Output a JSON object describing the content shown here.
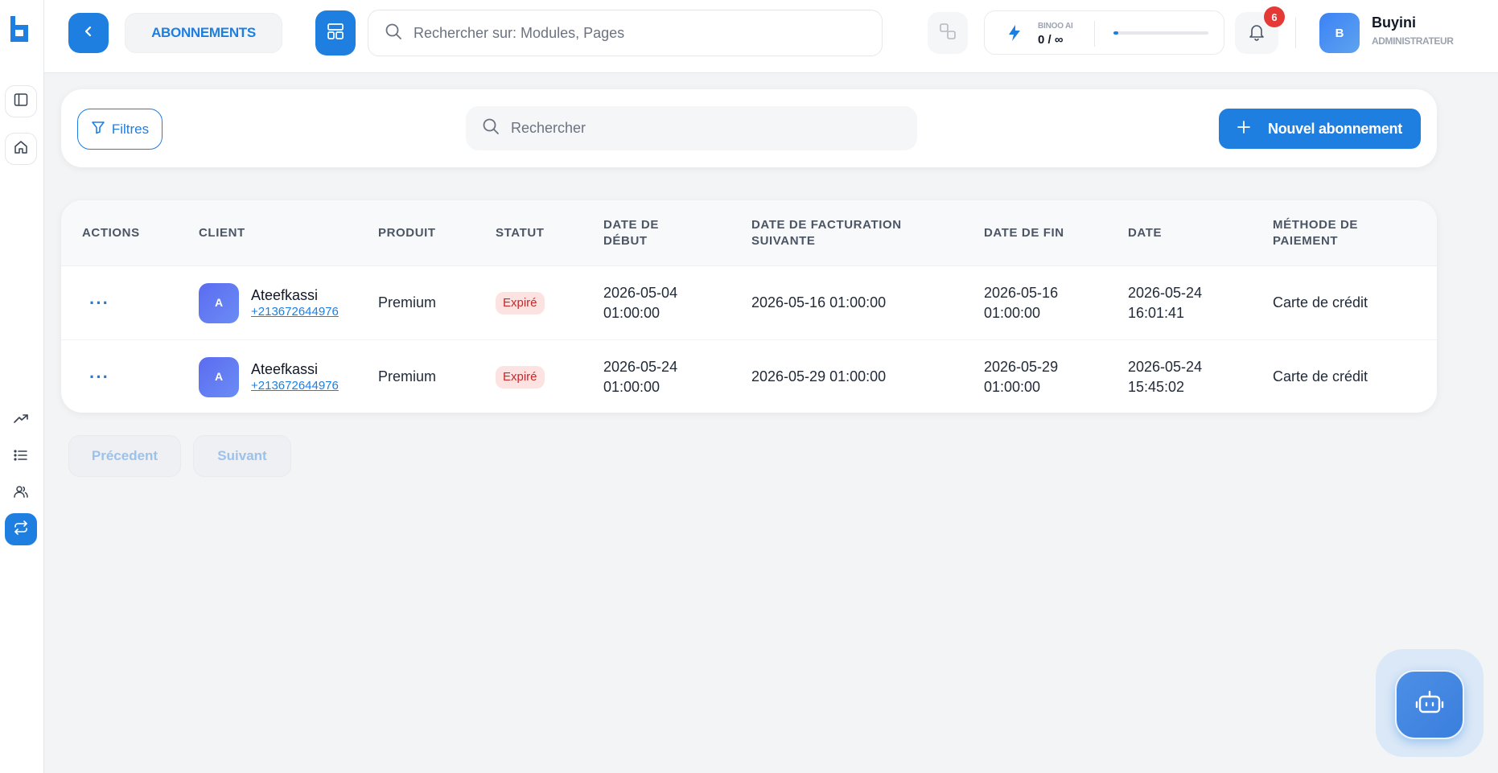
{
  "topbar": {
    "page_title": "ABONNEMENTS",
    "search_placeholder": "Rechercher sur: Modules, Pages",
    "ai_label": "BINOO AI",
    "ai_usage": "0 / ∞",
    "ai_progress_fraction": 0.05,
    "notification_count": "6",
    "user": {
      "initial": "B",
      "name": "Buyini",
      "role": "ADMINISTRATEUR"
    }
  },
  "toolbar": {
    "filters_label": "Filtres",
    "search_placeholder": "Rechercher",
    "new_label": "Nouvel abonnement"
  },
  "table": {
    "headers": {
      "actions": "ACTIONS",
      "client": "CLIENT",
      "product": "PRODUIT",
      "status": "STATUT",
      "start": "DATE DE DÉBUT",
      "next_billing": "DATE DE FACTURATION SUIVANTE",
      "end": "DATE DE FIN",
      "date": "DATE",
      "payment": "MÉTHODE DE PAIEMENT"
    },
    "rows": [
      {
        "actions": "···",
        "avatar": "A",
        "client_name": "Ateefkassi",
        "client_phone": "+213672644976",
        "product": "Premium",
        "status": "Expiré",
        "start": "2026-05-04 01:00:00",
        "next_billing": "2026-05-16 01:00:00",
        "end": "2026-05-16 01:00:00",
        "date": "2026-05-24 16:01:41",
        "payment": "Carte de crédit"
      },
      {
        "actions": "···",
        "avatar": "A",
        "client_name": "Ateefkassi",
        "client_phone": "+213672644976",
        "product": "Premium",
        "status": "Expiré",
        "start": "2026-05-24 01:00:00",
        "next_billing": "2026-05-29 01:00:00",
        "end": "2026-05-29 01:00:00",
        "date": "2026-05-24 15:45:02",
        "payment": "Carte de crédit"
      }
    ]
  },
  "pagination": {
    "prev_label": "Précedent",
    "next_label": "Suivant"
  },
  "colors": {
    "primary": "#1e7fe0",
    "danger": "#e53935",
    "badge_bg": "#fde2e2",
    "badge_text": "#c62828",
    "page_bg": "#f3f4f6"
  },
  "icons": {
    "logo": "app-logo",
    "sidebar": [
      "panel-toggle-icon",
      "home-icon",
      "trending-up-icon",
      "list-icon",
      "users-icon",
      "swap-arrows-icon"
    ],
    "topbar": [
      "chevron-left-icon",
      "layout-grid-icon",
      "search-icon",
      "translate-icon",
      "bolt-icon",
      "bell-icon"
    ],
    "toolbar": [
      "filter-icon",
      "search-icon",
      "plus-icon"
    ],
    "assistant": "robot-icon"
  }
}
